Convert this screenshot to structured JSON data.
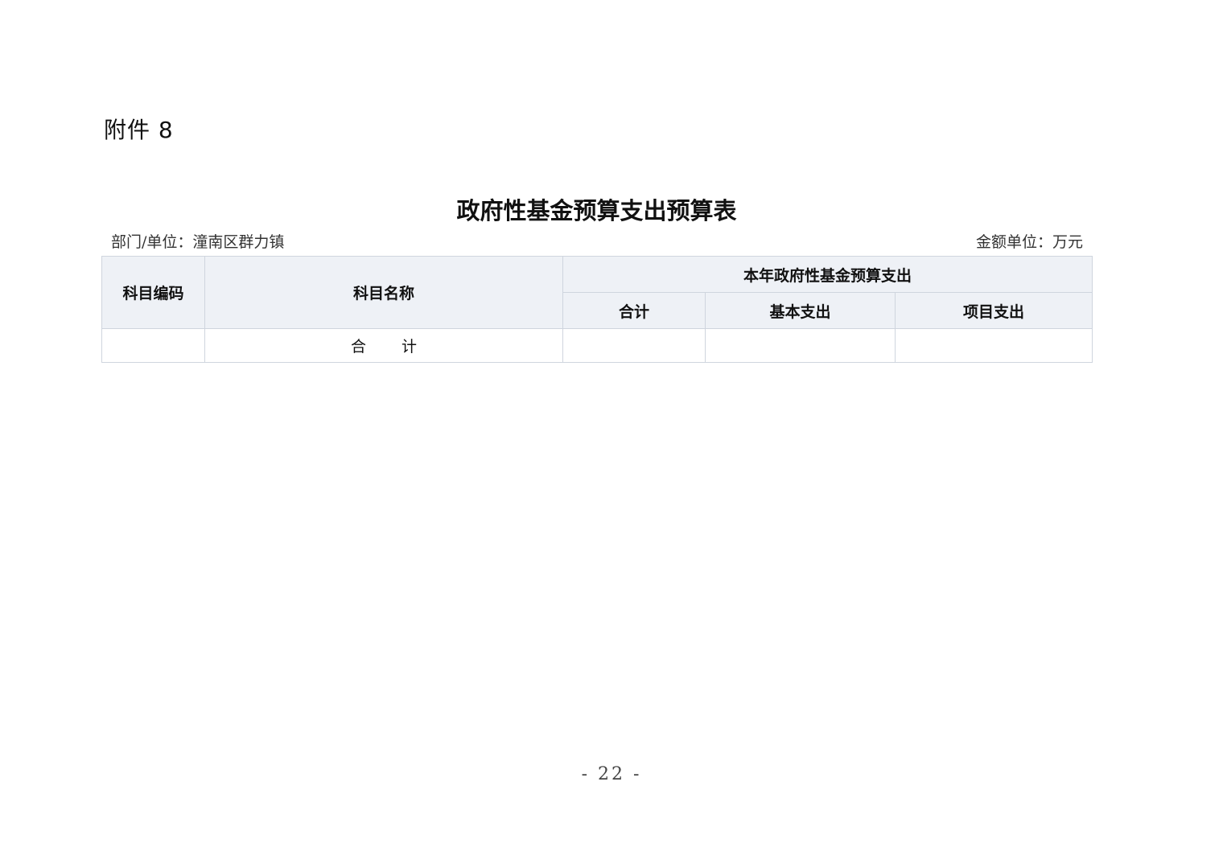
{
  "attachment_label": "附件 8",
  "title": "政府性基金预算支出预算表",
  "meta": {
    "department": "部门/单位：潼南区群力镇",
    "unit": "金额单位：万元"
  },
  "table": {
    "headers": {
      "code": "科目编码",
      "name": "科目名称",
      "group": "本年政府性基金预算支出",
      "total": "合计",
      "basic": "基本支出",
      "project": "项目支出"
    },
    "total_row": {
      "code": "",
      "name": "合计",
      "total": "",
      "basic": "",
      "project": ""
    }
  },
  "page_number": "- 22 -"
}
